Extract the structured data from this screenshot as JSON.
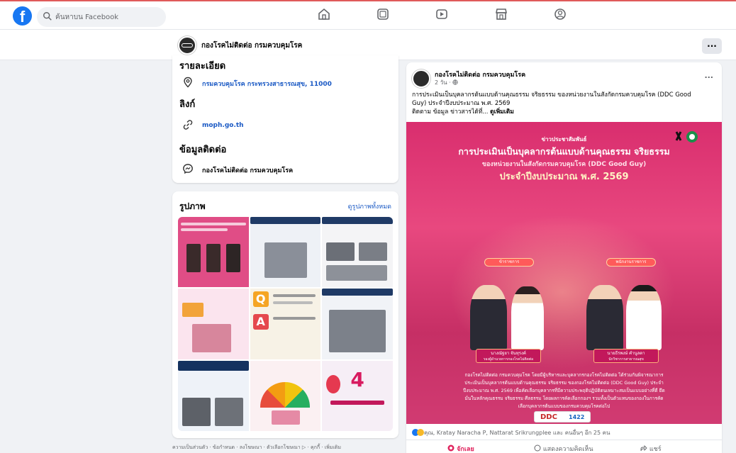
{
  "topbar": {
    "logo": "f",
    "search_placeholder": "ค้นหาบน Facebook",
    "nav_icons": [
      "home-icon",
      "pages-icon",
      "video-icon",
      "marketplace-icon",
      "gaming-icon"
    ]
  },
  "page_header": {
    "name": "กองโรคไม่ติดต่อ กรมควบคุมโรค",
    "more": "..."
  },
  "intro": {
    "details_title": "รายละเอียด",
    "address": "กรมควบคุมโรค กระทรวงสาธารณสุข, 11000",
    "links_title": "ลิงก์",
    "website": "moph.go.th",
    "contact_title": "ข้อมูลติดต่อ",
    "messenger": "กองโรคไม่ติดต่อ กรมควบคุมโรค"
  },
  "photos": {
    "title": "รูปภาพ",
    "see_all": "ดูรูปภาพทั้งหมด",
    "thumb_colors": [
      "#e04d86",
      "#eef1f6",
      "#f4f4f6",
      "#fbe4ee",
      "#f7f2e6",
      "#f1f3f7",
      "#eef2f8",
      "#fbf0f2",
      "#f6eef6"
    ],
    "thumb_text": {
      "qa_q": "Q",
      "qa_a": "A",
      "four": "4"
    }
  },
  "footer": {
    "links": "ความเป็นส่วนตัว · ข้อกำหนด · ลงโฆษณา · ตัวเลือกโฆษณา ▷ · คุกกี้ · เพิ่มเติม"
  },
  "post": {
    "author": "กองโรคไม่ติดต่อ กรมควบคุมโรค",
    "time": "2 วัน · ",
    "more": "...",
    "text_line1": "การประเมินเป็นบุคลากรต้นแบบด้านคุณธรรม จริยธรรม ของหน่วยงานในสังกัดกรมควบคุมโรค (DDC Good",
    "text_line2": "Guy) ประจำปีงบประมาณ พ.ศ. 2569",
    "text_line3": "ติดตาม ข้อมูล ข่าวสารได้ที่... ",
    "see_more": "ดูเพิ่มเติม",
    "poster": {
      "kicker": "ข่าวประชาสัมพันธ์",
      "title1": "การประเมินเป็นบุคลากรต้นแบบด้านคุณธรรม จริยธรรม",
      "title2": "ของหน่วยงานในสังกัดกรมควบคุมโรค (DDC Good Guy)",
      "title3": "ประจำปีงบประมาณ พ.ศ. 2569",
      "pill_left": "ข้าราชการ",
      "pill_right": "พนักงานราชการ",
      "name_left": "นางณัฐยา จันทุรงค์",
      "role_left": "รองผู้อำนวยการกองโรคไม่ติดต่อ",
      "name_right": "นายธีรพงษ์ คำนูลตา",
      "role_right": "นักวิชาการสาธารณสุข",
      "body": "กองโรคไม่ติดต่อ กรมควบคุมโรค โดยมีผู้บริหารและบุคลากรกองโรคไม่ติดต่อ ได้ร่วมกันพิจารณาการประเมินเป็นบุคลากรต้นแบบด้านคุณธรรม จริยธรรม ของกองโรคไม่ติดต่อ (DDC Good Guy) ประจำปีงบประมาณ พ.ศ. 2569 เพื่อคัดเลือกบุคลากรที่มีความประพฤติปฏิบัติตนเหมาะสมเป็นแบบอย่างที่ดี ยึดมั่นในหลักคุณธรรม จริยธรรม ศีลธรรม โดยผลการคัดเลือกกองฯ รวมทั้งเป็นตัวแทนของกองในการคัดเลือกบุคลากรต้นแบบของกรมควบคุมโรคต่อไป",
      "ddc": "DDC",
      "hotline": "1422"
    },
    "reactions": "คุณ, Kratay Naracha P, Nattarat Srikrungplee และ คนอื่นๆ อีก 25 คน",
    "action_support": "จักเลย",
    "action_comment": "แสดงความคิดเห็น",
    "action_share": "แชร์"
  }
}
